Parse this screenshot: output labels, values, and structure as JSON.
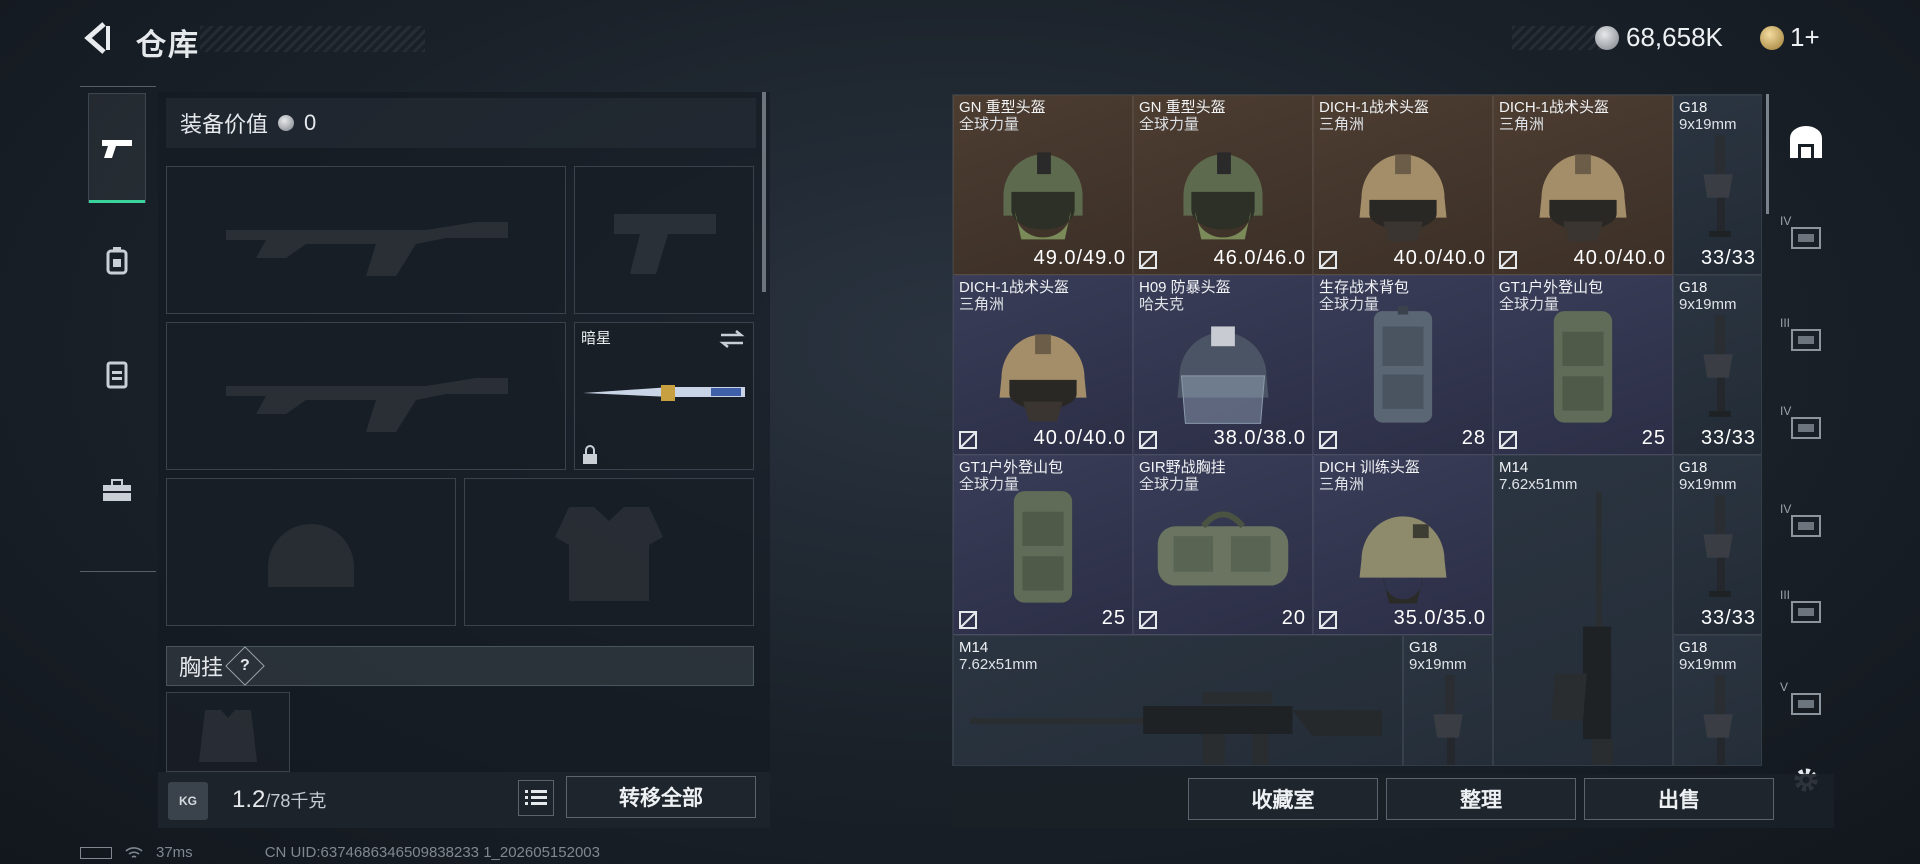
{
  "header": {
    "title": "仓库",
    "currency_silver": "68,658K",
    "currency_gold": "1+"
  },
  "left_tabs": [
    "pistol-icon",
    "backpack-icon",
    "vest-icon",
    "toolbox-icon"
  ],
  "loadout": {
    "equip_value_label": "装备价值",
    "equip_value": "0",
    "melee_name": "暗星",
    "chest_section_label": "胸挂",
    "chest_help": "?",
    "weight_current": "1.2",
    "weight_max": "/78千克",
    "kg_label": "KG",
    "transfer_all": "转移全部"
  },
  "inventory": [
    {
      "name": "GN 重型头盔",
      "sub": "全球力量",
      "value": "49.0/49.0",
      "rarity": "brown",
      "kind": "helmet-gn"
    },
    {
      "name": "GN 重型头盔",
      "sub": "全球力量",
      "value": "46.0/46.0",
      "rarity": "brown",
      "kind": "helmet-gn"
    },
    {
      "name": "DICH-1战术头盔",
      "sub": "三角洲",
      "value": "40.0/40.0",
      "rarity": "brown",
      "kind": "helmet-dich"
    },
    {
      "name": "DICH-1战术头盔",
      "sub": "三角洲",
      "value": "40.0/40.0",
      "rarity": "brown",
      "kind": "helmet-dich"
    },
    {
      "name": "G18",
      "sub": "9x19mm",
      "value": "33/33",
      "rarity": "dark",
      "kind": "mag"
    },
    {
      "name": "DICH-1战术头盔",
      "sub": "三角洲",
      "value": "40.0/40.0",
      "rarity": "purple",
      "kind": "helmet-dich"
    },
    {
      "name": "H09 防暴头盔",
      "sub": "哈夫克",
      "value": "38.0/38.0",
      "rarity": "purple",
      "kind": "helmet-h09"
    },
    {
      "name": "生存战术背包",
      "sub": "全球力量",
      "value": "28",
      "rarity": "purple",
      "kind": "backpack"
    },
    {
      "name": "GT1户外登山包",
      "sub": "全球力量",
      "value": "25",
      "rarity": "purple",
      "kind": "backpack-green"
    },
    {
      "name": "G18",
      "sub": "9x19mm",
      "value": "33/33",
      "rarity": "dark",
      "kind": "mag"
    },
    {
      "name": "GT1户外登山包",
      "sub": "全球力量",
      "value": "25",
      "rarity": "purple",
      "kind": "backpack-green"
    },
    {
      "name": "GIR野战胸挂",
      "sub": "全球力量",
      "value": "20",
      "rarity": "purple",
      "kind": "bag"
    },
    {
      "name": "DICH 训练头盔",
      "sub": "三角洲",
      "value": "35.0/35.0",
      "rarity": "purple",
      "kind": "helmet-train"
    },
    {
      "name": "M14",
      "sub": "7.62x51mm",
      "value": "",
      "rarity": "dark",
      "kind": "rifle-v"
    },
    {
      "name": "G18",
      "sub": "9x19mm",
      "value": "33/33",
      "rarity": "dark",
      "kind": "mag"
    },
    {
      "name": "M14",
      "sub": "7.62x51mm",
      "value": "",
      "rarity": "dark",
      "kind": "rifle-h"
    },
    {
      "name": "G18",
      "sub": "9x19mm",
      "value": "",
      "rarity": "dark",
      "kind": "mag"
    },
    {
      "name": "G18",
      "sub": "9x19mm",
      "value": "",
      "rarity": "dark",
      "kind": "mag"
    }
  ],
  "right_tabs": [
    "IV",
    "III",
    "IV",
    "IV",
    "III",
    "V"
  ],
  "bottom_buttons": {
    "collection": "收藏室",
    "organize": "整理",
    "sell": "出售"
  },
  "status_bar": {
    "ping": "37ms",
    "uid": "CN UID:6374686346509838233 1_202605152003"
  },
  "colors": {
    "accent_green": "#3ad39b",
    "rarity_brown": "#4d3d31",
    "rarity_purple": "#3a3d58"
  }
}
